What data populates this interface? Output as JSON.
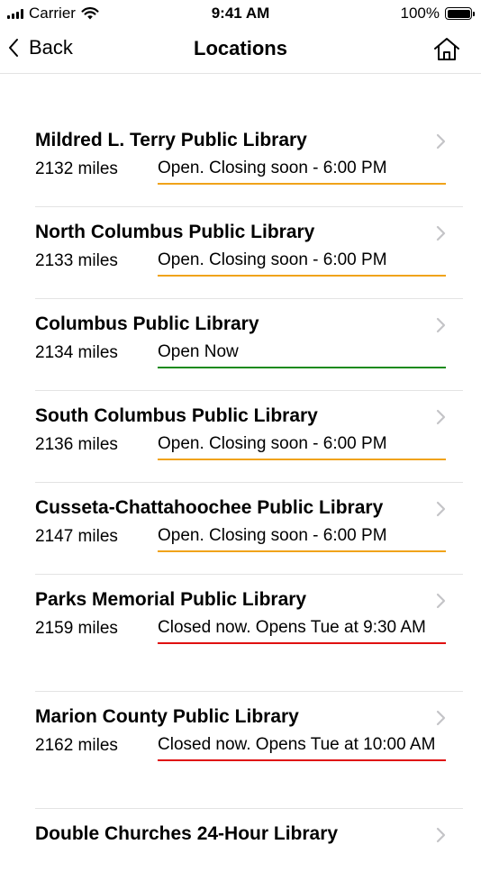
{
  "status_bar": {
    "carrier": "Carrier",
    "time": "9:41 AM",
    "battery": "100%"
  },
  "nav": {
    "back_label": "Back",
    "title": "Locations"
  },
  "locations": [
    {
      "name": "Mildred L. Terry Public Library",
      "distance": "2132 miles",
      "status": "Open. Closing soon - 6:00 PM",
      "state": "soon"
    },
    {
      "name": "North Columbus Public Library",
      "distance": "2133 miles",
      "status": "Open. Closing soon - 6:00 PM",
      "state": "soon"
    },
    {
      "name": "Columbus Public Library",
      "distance": "2134 miles",
      "status": "Open Now",
      "state": "open"
    },
    {
      "name": "South Columbus Public Library",
      "distance": "2136 miles",
      "status": "Open. Closing soon - 6:00 PM",
      "state": "soon"
    },
    {
      "name": "Cusseta-Chattahoochee Public Library",
      "distance": "2147 miles",
      "status": "Open. Closing soon - 6:00 PM",
      "state": "soon"
    },
    {
      "name": "Parks Memorial Public Library",
      "distance": "2159 miles",
      "status": "Closed now. Opens Tue at 9:30 AM",
      "state": "closed"
    },
    {
      "name": "Marion County Public Library",
      "distance": "2162 miles",
      "status": "Closed now. Opens Tue at 10:00 AM",
      "state": "closed"
    },
    {
      "name": "Double Churches 24-Hour Library",
      "distance": "",
      "status": "",
      "state": ""
    }
  ],
  "colors": {
    "closing_soon": "#f0a31a",
    "open": "#1a8a1a",
    "closed": "#e01010",
    "chevron": "#c4c4c7",
    "separator": "#e3e3e3"
  },
  "icons": {
    "back": "chevron-left-icon",
    "home": "home-icon",
    "row_disclosure": "chevron-right-icon",
    "signal": "cellular-signal-icon",
    "wifi": "wifi-icon",
    "battery": "battery-icon"
  }
}
